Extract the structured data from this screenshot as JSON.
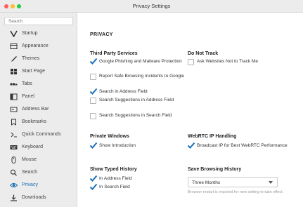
{
  "window": {
    "title": "Privacy Settings"
  },
  "sidebar": {
    "search_placeholder": "Search",
    "items": [
      {
        "label": "Startup",
        "icon": "startup-icon"
      },
      {
        "label": "Appearance",
        "icon": "appearance-icon"
      },
      {
        "label": "Themes",
        "icon": "themes-icon"
      },
      {
        "label": "Start Page",
        "icon": "start-page-icon"
      },
      {
        "label": "Tabs",
        "icon": "tabs-icon"
      },
      {
        "label": "Panel",
        "icon": "panel-icon"
      },
      {
        "label": "Address Bar",
        "icon": "address-bar-icon"
      },
      {
        "label": "Bookmarks",
        "icon": "bookmarks-icon"
      },
      {
        "label": "Quick Commands",
        "icon": "quick-commands-icon"
      },
      {
        "label": "Keyboard",
        "icon": "keyboard-icon"
      },
      {
        "label": "Mouse",
        "icon": "mouse-icon"
      },
      {
        "label": "Search",
        "icon": "search-icon"
      },
      {
        "label": "Privacy",
        "icon": "privacy-icon",
        "active": true
      },
      {
        "label": "Downloads",
        "icon": "downloads-icon"
      }
    ]
  },
  "main": {
    "heading": "PRIVACY",
    "third_party": {
      "title": "Third Party Services",
      "options": [
        {
          "label": "Google Phishing and Malware Protection",
          "checked": true
        },
        {
          "label": "Report Safe Browsing Incidents to Google",
          "checked": false
        },
        {
          "label": "Search in Address Field",
          "checked": true
        },
        {
          "label": "Search Suggestions in Address Field",
          "checked": false
        },
        {
          "label": "Search Suggestions in Search Field",
          "checked": false
        }
      ]
    },
    "do_not_track": {
      "title": "Do Not Track",
      "options": [
        {
          "label": "Ask Websites Not to Track Me",
          "checked": false
        }
      ]
    },
    "private_windows": {
      "title": "Private Windows",
      "options": [
        {
          "label": "Show Introduction",
          "checked": true
        }
      ]
    },
    "webrtc": {
      "title": "WebRTC IP Handling",
      "options": [
        {
          "label": "Broadcast IP for Best WebRTC Performance",
          "checked": true
        }
      ]
    },
    "typed_history": {
      "title": "Show Typed History",
      "options": [
        {
          "label": "In Address Field",
          "checked": true
        },
        {
          "label": "In Search Field",
          "checked": true
        }
      ]
    },
    "browsing_history": {
      "title": "Save Browsing History",
      "selected": "Three Months",
      "note": "Browser restart is required for new setting to take effect."
    }
  },
  "colors": {
    "accent": "#1a6fb8",
    "sidebar_bg": "#ececec"
  }
}
